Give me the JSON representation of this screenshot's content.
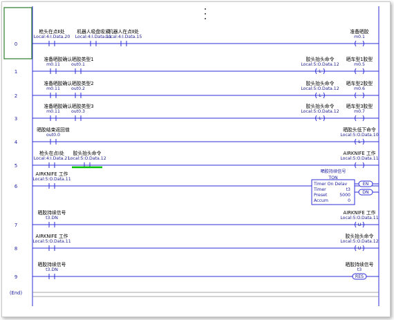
{
  "rungs": [
    {
      "num": "0",
      "coils": [
        {
          "type": "OTE",
          "sym": "( )",
          "tag": "准备晒胶",
          "addr": "m0.1"
        }
      ],
      "contacts": [
        {
          "type": "XIC",
          "tag": "枪头在点Ⅱ处",
          "addr": "Local:4:I.Data.20"
        },
        {
          "type": "XIC",
          "tag": "机器人吸盘吸紧",
          "addr": "Local:4:I.Data.11"
        },
        {
          "type": "XIC",
          "tag": "机器人在点Ⅱ处",
          "addr": "Local:4:I.Data.15"
        }
      ]
    },
    {
      "num": "1",
      "contacts": [
        {
          "type": "XIC",
          "tag": "准备晒胶",
          "addr": "m0.11"
        },
        {
          "type": "XIC",
          "tag": "确认晒胶类型1",
          "addr": "out0.1"
        }
      ],
      "coils": [
        {
          "type": "OTL",
          "sym": "(L)",
          "tag": "胶头抬头命令",
          "addr": "Local:5:O.Data.12"
        },
        {
          "type": "OTE",
          "sym": "( )",
          "tag": "晒车型1胶型",
          "addr": "m0.5"
        }
      ]
    },
    {
      "num": "2",
      "contacts": [
        {
          "type": "XIC",
          "tag": "准备晒胶",
          "addr": "m0.11"
        },
        {
          "type": "XIC",
          "tag": "确认晒胶类型2",
          "addr": "out0.2"
        }
      ],
      "coils": [
        {
          "type": "OTL",
          "sym": "(L)",
          "tag": "胶头抬头命令",
          "addr": "Local:5:O.Data.12"
        },
        {
          "type": "OTE",
          "sym": "( )",
          "tag": "晒车型2胶型",
          "addr": "m0.6"
        }
      ]
    },
    {
      "num": "3",
      "contacts": [
        {
          "type": "XIC",
          "tag": "准备晒胶",
          "addr": "m0.11"
        },
        {
          "type": "XIC",
          "tag": "确认晒胶类型3",
          "addr": "out0.3"
        }
      ],
      "coils": [
        {
          "type": "OTL",
          "sym": "(L)",
          "tag": "胶头抬头命令",
          "addr": "Local:5:O.Data.12"
        },
        {
          "type": "OTE",
          "sym": "( )",
          "tag": "晒车型3胶型",
          "addr": "m0.7"
        }
      ]
    },
    {
      "num": "4",
      "contacts": [
        {
          "type": "XIC",
          "tag": "晒胶结束返回值",
          "addr": "out0.0"
        }
      ],
      "coils": [
        {
          "type": "OTL",
          "sym": "(L)",
          "tag": "晒胶头低下命令",
          "addr": "Local:5:O.Data.10"
        }
      ]
    },
    {
      "num": "5",
      "contacts": [
        {
          "type": "XIC",
          "tag": "枪头在点Ⅰ处",
          "addr": "Local:4:I.Data.21"
        },
        {
          "type": "XIC",
          "tag": "胶头抬头命令",
          "addr": "Local:5:O.Data.12"
        }
      ],
      "coils": [
        {
          "type": "OTE",
          "sym": "( )",
          "tag": "AIRKNIFE 工作",
          "addr": "Local:5:O.Data.11"
        }
      ]
    },
    {
      "num": "6",
      "contacts": [
        {
          "type": "XIC",
          "tag": "AIRKNIFE 工作",
          "addr": "Local:5:O.Data.11"
        }
      ],
      "timer": {
        "title": "晒胶持续信号",
        "name": "TON",
        "label": "Timer On Delay",
        "timer_label": "Timer",
        "timer_val": "t3",
        "preset_label": "Preset",
        "preset_val": "5000",
        "accum_label": "Accum",
        "accum_val": "0",
        "en": "EN",
        "dn": "DN"
      }
    },
    {
      "num": "7",
      "contacts": [
        {
          "type": "XIC",
          "tag": "晒胶持续信号",
          "addr": "t3.DN"
        }
      ],
      "coils": [
        {
          "type": "OTU",
          "sym": "(U)",
          "tag": "AIRKNIFE 工作",
          "addr": "Local:5:O.Data.11"
        }
      ]
    },
    {
      "num": "8",
      "contacts": [
        {
          "type": "XIC",
          "tag": "AIRKNIFE 工作",
          "addr": "Local:5:O.Data.11"
        }
      ],
      "coils": [
        {
          "type": "OTU",
          "sym": "(U)",
          "tag": "胶头抬头命令",
          "addr": "Local:5:O.Data.12"
        }
      ]
    },
    {
      "num": "9",
      "contacts": [
        {
          "type": "XIC",
          "tag": "晒胶持续信号",
          "addr": "t3.DN"
        }
      ],
      "coils": [
        {
          "type": "RES",
          "sym": "RES",
          "tag": "晒胶持续信号",
          "addr": "t3"
        }
      ]
    },
    {
      "num": "(End)"
    }
  ],
  "colors": {
    "wire": "#2b2bd9",
    "highlight": "#00c000",
    "selected": "#2b2bd9"
  }
}
